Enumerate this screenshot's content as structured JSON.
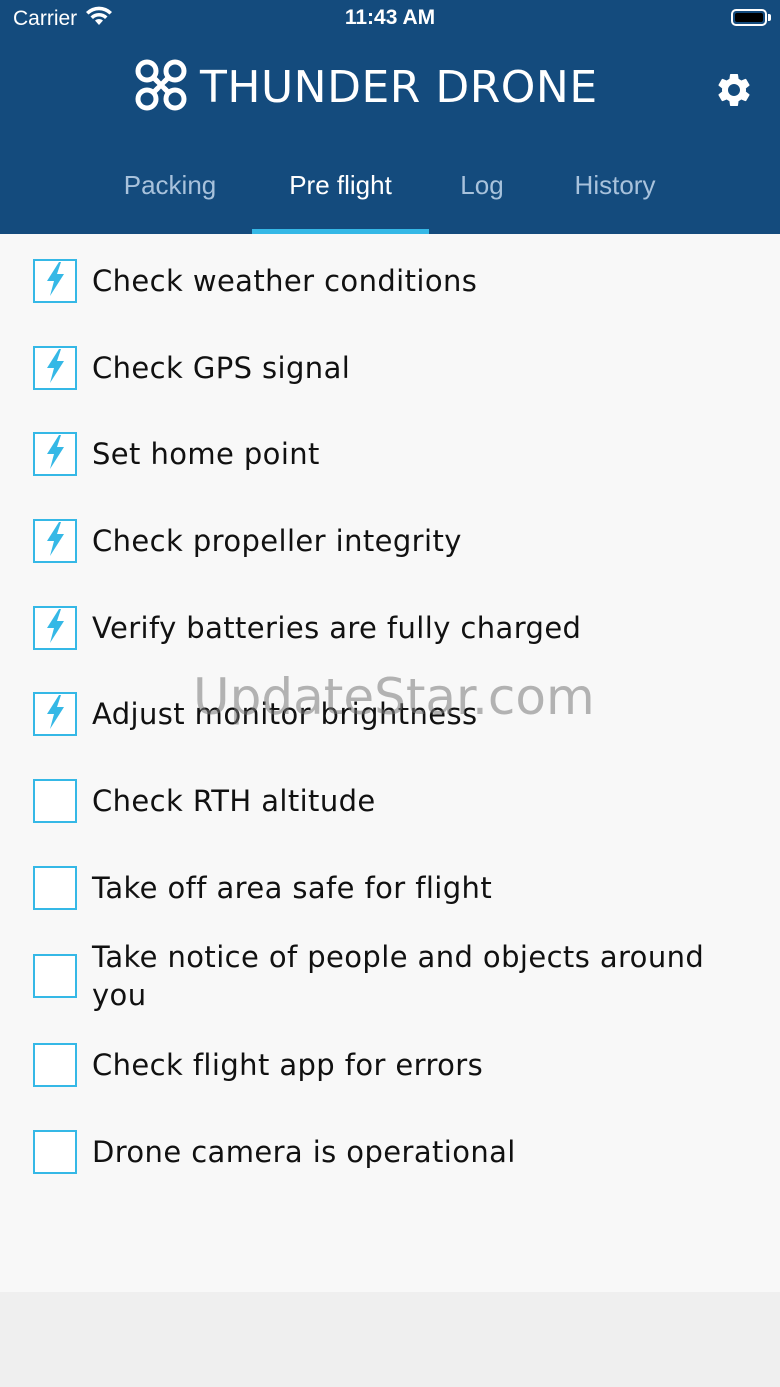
{
  "status_bar": {
    "carrier": "Carrier",
    "time": "11:43 AM"
  },
  "header": {
    "brand_name": "THUNDER DRONE",
    "logo_icon": "drone-icon",
    "settings_icon": "gear-icon",
    "background_color": "#144b7d",
    "accent_color": "#35b8e6"
  },
  "tabs": [
    {
      "label": "Packing",
      "active": false
    },
    {
      "label": "Pre flight",
      "active": true
    },
    {
      "label": "Log",
      "active": false
    },
    {
      "label": "History",
      "active": false
    }
  ],
  "checklist": [
    {
      "label": "Check weather conditions",
      "checked": true
    },
    {
      "label": "Check GPS signal",
      "checked": true
    },
    {
      "label": "Set home point",
      "checked": true
    },
    {
      "label": "Check propeller integrity",
      "checked": true
    },
    {
      "label": "Verify batteries are fully charged",
      "checked": true
    },
    {
      "label": "Adjust monitor brightness",
      "checked": true
    },
    {
      "label": "Check RTH altitude",
      "checked": false
    },
    {
      "label": "Take off area safe for flight",
      "checked": false
    },
    {
      "label": "Take notice of people and objects around you",
      "checked": false
    },
    {
      "label": "Check flight app for errors",
      "checked": false
    },
    {
      "label": "Drone camera is operational",
      "checked": false
    }
  ],
  "checked_icon": "lightning-bolt-icon",
  "watermark": "UpdateStar.com"
}
